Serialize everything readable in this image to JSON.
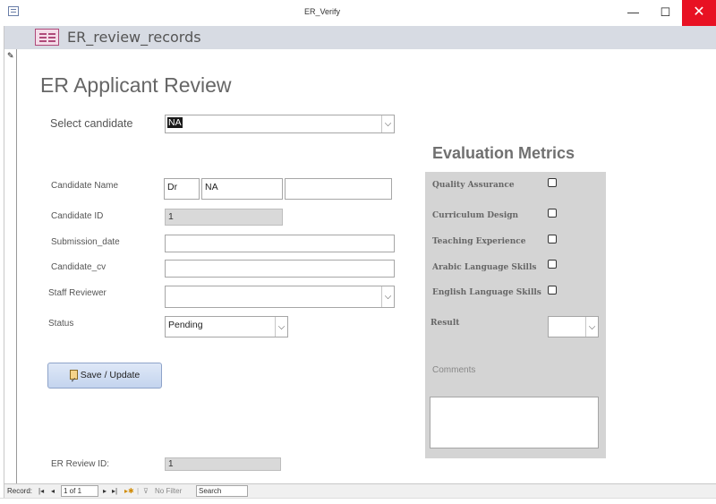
{
  "window": {
    "title": "ER_Verify",
    "minimize_glyph": "—",
    "maximize_glyph": "☐",
    "close_glyph": "✕"
  },
  "form_header": {
    "title": "ER_review_records"
  },
  "page_title": "ER Applicant Review",
  "select_candidate": {
    "label": "Select candidate",
    "value": "NA"
  },
  "candidate_name": {
    "label": "Candidate Name",
    "prefix": "Dr",
    "first": "NA",
    "last": ""
  },
  "candidate_id": {
    "label": "Candidate ID",
    "value": "1"
  },
  "submission_date": {
    "label": "Submission_date",
    "value": ""
  },
  "candidate_cv": {
    "label": "Candidate_cv",
    "value": ""
  },
  "staff_reviewer": {
    "label": "Staff Reviewer",
    "value": ""
  },
  "status": {
    "label": "Status",
    "value": "Pending"
  },
  "save_button": {
    "label": "Save / Update"
  },
  "er_review_id": {
    "label": "ER Review ID:",
    "value": "1"
  },
  "evaluation": {
    "title": "Evaluation Metrics",
    "metrics": [
      {
        "label": "Quality Assurance",
        "checked": false
      },
      {
        "label": "Curriculum Design",
        "checked": false
      },
      {
        "label": "Teaching Experience",
        "checked": false
      },
      {
        "label": "Arabic Language Skills",
        "checked": false
      },
      {
        "label": "English Language Skills",
        "checked": false
      }
    ],
    "result_label": "Result",
    "result_value": "",
    "comments_label": "Comments",
    "comments_value": ""
  },
  "status_bar": {
    "record_label": "Record:",
    "record_position": "1 of 1",
    "filter_label": "No Filter",
    "search_placeholder": "Search"
  },
  "colors": {
    "close_button": "#e81123",
    "panel": "#d4d4d4",
    "header_band": "#d7dbe3"
  }
}
